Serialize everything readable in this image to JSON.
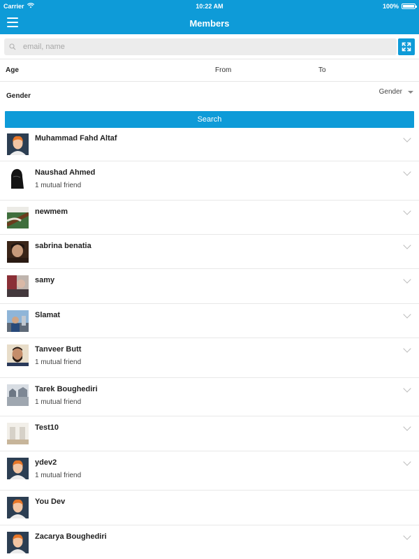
{
  "status": {
    "carrier": "Carrier",
    "time": "10:22 AM",
    "battery": "100%",
    "battery_level": 1.0
  },
  "header": {
    "title": "Members",
    "menu_icon": "hamburger-icon"
  },
  "search": {
    "placeholder": "email, name",
    "value": "",
    "icon": "search-icon",
    "expand_icon": "expand-icon"
  },
  "filters": {
    "age_label": "Age",
    "from_label": "From",
    "to_label": "To",
    "gender_label": "Gender",
    "gender_value": "Gender"
  },
  "search_button": "Search",
  "accent_color": "#0e9bd8",
  "members": [
    {
      "name": "Muhammad Fahd Altaf",
      "sub": "",
      "avatar": "default-avatar",
      "has_chevron": true
    },
    {
      "name": "Naushad Ahmed",
      "sub": "1 mutual friend",
      "avatar": "photo-dark",
      "has_chevron": true
    },
    {
      "name": "newmem",
      "sub": "",
      "avatar": "photo-guitar",
      "has_chevron": true
    },
    {
      "name": "sabrina benatia",
      "sub": "",
      "avatar": "photo-portrait",
      "has_chevron": true
    },
    {
      "name": "samy",
      "sub": "",
      "avatar": "photo-crowd",
      "has_chevron": true
    },
    {
      "name": "Slamat",
      "sub": "",
      "avatar": "photo-street",
      "has_chevron": true
    },
    {
      "name": "Tanveer Butt",
      "sub": "1 mutual friend",
      "avatar": "photo-man",
      "has_chevron": true
    },
    {
      "name": "Tarek Boughediri",
      "sub": "1 mutual friend",
      "avatar": "photo-building",
      "has_chevron": true
    },
    {
      "name": "Test10",
      "sub": "",
      "avatar": "photo-interior",
      "has_chevron": true
    },
    {
      "name": "ydev2",
      "sub": "1 mutual friend",
      "avatar": "default-avatar",
      "has_chevron": true
    },
    {
      "name": "You Dev",
      "sub": "",
      "avatar": "default-avatar",
      "has_chevron": false
    },
    {
      "name": "Zacarya Boughediri",
      "sub": "",
      "avatar": "default-avatar",
      "has_chevron": true
    }
  ]
}
